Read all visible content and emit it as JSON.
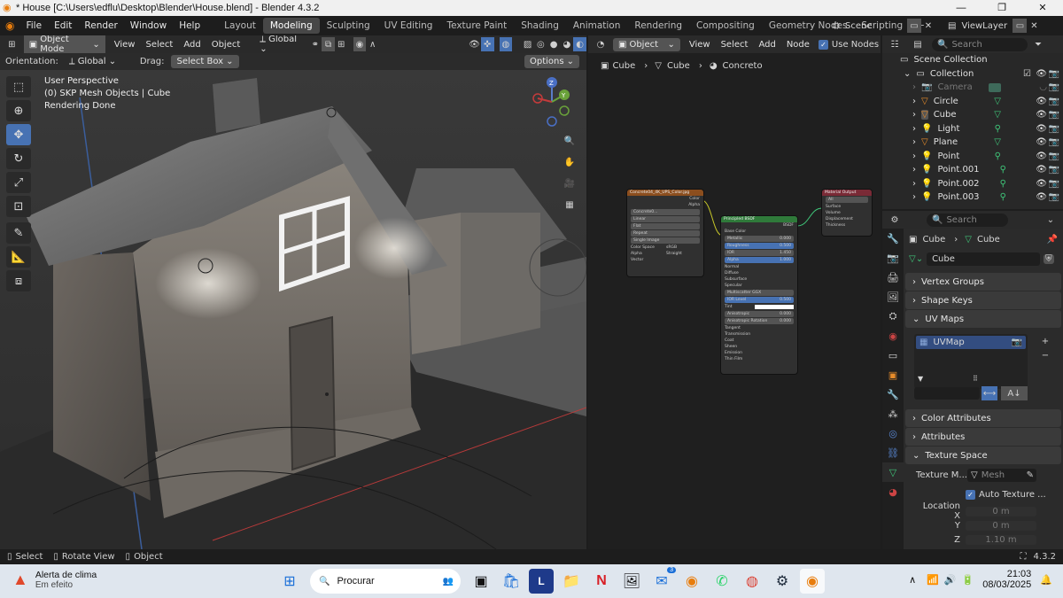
{
  "window": {
    "title": "* House [C:\\Users\\edflu\\Desktop\\Blender\\House.blend] - Blender 4.3.2",
    "min": "—",
    "max": "❐",
    "close": "✕"
  },
  "menu": [
    "File",
    "Edit",
    "Render",
    "Window",
    "Help"
  ],
  "workspaces": [
    "Layout",
    "Modeling",
    "Sculpting",
    "UV Editing",
    "Texture Paint",
    "Shading",
    "Animation",
    "Rendering",
    "Compositing",
    "Geometry Nodes",
    "Scripting"
  ],
  "add_workspace": "+",
  "scene": {
    "name": "Scene",
    "viewlayer": "ViewLayer"
  },
  "viewport": {
    "mode": "Object Mode",
    "menus": [
      "View",
      "Select",
      "Add",
      "Object"
    ],
    "orientation_value": "Global",
    "orientation_label": "Orientation:",
    "orientation_select": "Global",
    "drag_label": "Drag:",
    "drag_value": "Select Box",
    "options": "Options",
    "overlay": [
      "User Perspective",
      "(0) SKP Mesh Objects | Cube",
      "Rendering Done"
    ],
    "gizmo": {
      "x": "X",
      "y": "Y",
      "z": "Z"
    }
  },
  "node_editor": {
    "type": "Object",
    "menus": [
      "View",
      "Select",
      "Add",
      "Node"
    ],
    "use_nodes": "Use Nodes",
    "breadcrumb": [
      "Cube",
      "Cube",
      "Concreto"
    ],
    "img_node": {
      "title": "Concrete04_4K_UPS_Color.jpg",
      "out": [
        "Color",
        "Alpha"
      ],
      "file": "Concrete0...",
      "rows": [
        "Linear",
        "Flat",
        "Repeat",
        "Single Image"
      ],
      "cs_label": "Color Space",
      "cs_value": "sRGB",
      "alpha_label": "Alpha",
      "alpha_value": "Straight",
      "vector": "Vector"
    },
    "bsdf": {
      "title": "Principled BSDF",
      "out": "BSDF",
      "base": "Base Color",
      "sliders": [
        [
          "Metallic",
          "0.000"
        ],
        [
          "Roughness",
          "0.500"
        ],
        [
          "IOR",
          "1.450"
        ],
        [
          "Alpha",
          "1.000"
        ]
      ],
      "rows1": [
        "Normal",
        "Diffuse",
        "Subsurface",
        "Specular"
      ],
      "multi": "Multiscatter GGX",
      "spec": [
        [
          "IOR Level",
          "0.500"
        ]
      ],
      "tint": "Tint",
      "spec2": [
        [
          "Anisotropic",
          "0.000"
        ],
        [
          "Anisotropic Rotation",
          "0.000"
        ]
      ],
      "rows2": [
        "Tangent",
        "Transmission",
        "Coat",
        "Sheen",
        "Emission",
        "Thin Film"
      ]
    },
    "output": {
      "title": "Material Output",
      "sel": "All",
      "sockets": [
        "Surface",
        "Volume",
        "Displacement",
        "Thickness"
      ]
    }
  },
  "outliner": {
    "search": "Search",
    "scene_collection": "Scene Collection",
    "collection": "Collection",
    "items": [
      "Camera",
      "Circle",
      "Cube",
      "Light",
      "Plane",
      "Point",
      "Point.001",
      "Point.002",
      "Point.003"
    ]
  },
  "properties": {
    "search": "Search",
    "breadcrumb": [
      "Cube",
      "Cube"
    ],
    "mesh_name": "Cube",
    "panels": [
      "Vertex Groups",
      "Shape Keys",
      "UV Maps"
    ],
    "uvmap": "UVMap",
    "panels2": [
      "Color Attributes",
      "Attributes",
      "Texture Space"
    ],
    "texture_mesh_label": "Texture M...",
    "texture_mesh_placeholder": "Mesh",
    "auto_texture": "Auto Texture ...",
    "location_x_label": "Location X",
    "location_y_label": "Y",
    "location_z_label": "Z",
    "loc_x": "0 m",
    "loc_y": "0 m",
    "loc_z": "1.10 m"
  },
  "status": {
    "select": "Select",
    "rotate": "Rotate View",
    "object": "Object",
    "version": "4.3.2"
  },
  "taskbar": {
    "weather_title": "Alerta de clima",
    "weather_sub": "Em efeito",
    "search": "Procurar",
    "time": "21:03",
    "date": "08/03/2025",
    "badge": "3"
  },
  "colors": {
    "accent": "#4772b3",
    "selected_row": "#334d80",
    "active_tab": "#474747"
  }
}
